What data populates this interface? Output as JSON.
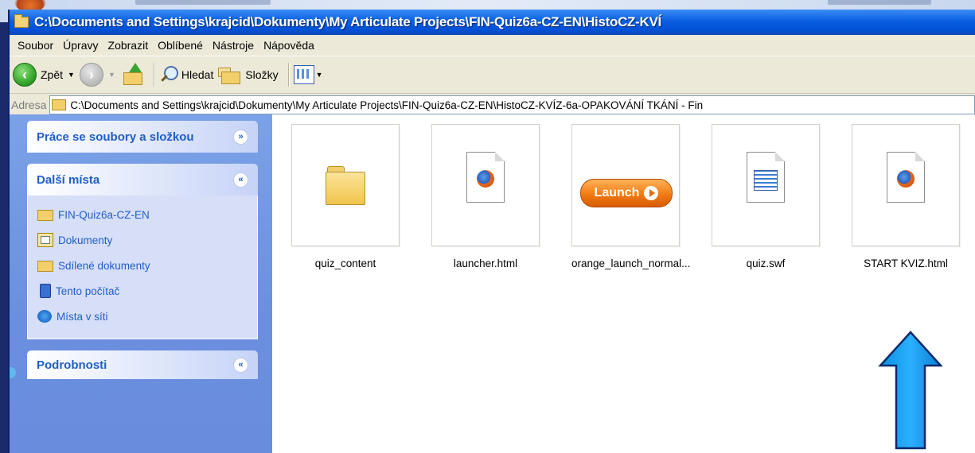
{
  "window": {
    "title": "C:\\Documents and Settings\\krajcid\\Dokumenty\\My Articulate Projects\\FIN-Quiz6a-CZ-EN\\HistoCZ-KVÍ"
  },
  "menu": [
    "Soubor",
    "Úpravy",
    "Zobrazit",
    "Oblíbené",
    "Nástroje",
    "Nápověda"
  ],
  "toolbar": {
    "back_label": "Zpět",
    "search_label": "Hledat",
    "folders_label": "Složky"
  },
  "address": {
    "label": "Adresa",
    "path": "C:\\Documents and Settings\\krajcid\\Dokumenty\\My Articulate Projects\\FIN-Quiz6a-CZ-EN\\HistoCZ-KVÍZ-6a-OPAKOVÁNÍ TKÁNÍ - Fin"
  },
  "sidebar": {
    "panels": [
      {
        "title": "Práce se soubory a složkou",
        "chevron": "»",
        "expanded": false
      },
      {
        "title": "Další místa",
        "chevron": "«",
        "expanded": true,
        "items": [
          {
            "label": "FIN-Quiz6a-CZ-EN",
            "icon": "folder-icon"
          },
          {
            "label": "Dokumenty",
            "icon": "my-documents-icon"
          },
          {
            "label": "Sdílené dokumenty",
            "icon": "folder-icon"
          },
          {
            "label": "Tento počítač",
            "icon": "computer-icon"
          },
          {
            "label": "Místa v síti",
            "icon": "network-icon"
          }
        ]
      },
      {
        "title": "Podrobnosti",
        "chevron": "«",
        "expanded": false
      }
    ]
  },
  "files": [
    {
      "name": "quiz_content",
      "type": "folder"
    },
    {
      "name": "launcher.html",
      "type": "html"
    },
    {
      "name": "orange_launch_normal...",
      "type": "image",
      "thumb_text": "Launch"
    },
    {
      "name": "quiz.swf",
      "type": "swf"
    },
    {
      "name": "START KVIZ.html",
      "type": "html"
    }
  ],
  "annotation": {
    "color": "#0a8fe0",
    "target": "START KVIZ.html"
  }
}
